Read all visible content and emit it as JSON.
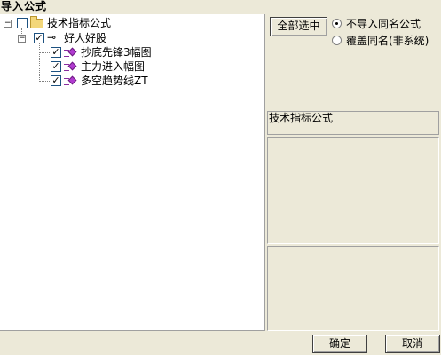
{
  "window": {
    "title": "导入公式"
  },
  "tree": {
    "root": {
      "label": "技术指标公式",
      "expanded": true,
      "checked": false
    },
    "group": {
      "label": "好人好股",
      "expanded": true,
      "checked": true
    },
    "items": [
      {
        "label": "抄底先锋3幅图",
        "checked": true
      },
      {
        "label": "主力进入幅图",
        "checked": true
      },
      {
        "label": "多空趋势线ZT",
        "checked": true
      }
    ]
  },
  "options": {
    "select_all_label": "全部选中",
    "radio_skip_label": "不导入同名公式",
    "radio_overwrite_label": "覆盖同名(非系统)",
    "selected": "skip"
  },
  "info": {
    "category_label": "技术指标公式"
  },
  "footer": {
    "ok_label": "确定",
    "cancel_label": "取消"
  },
  "colors": {
    "background": "#ece9d8",
    "folder": "#f3d77a",
    "formula_icon": "#b13bd0"
  }
}
